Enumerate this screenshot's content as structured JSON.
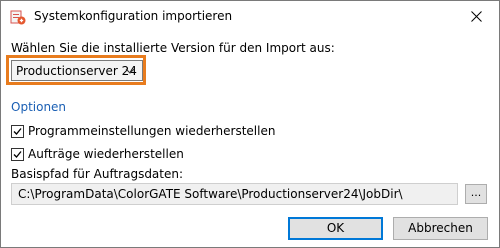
{
  "window": {
    "title": "Systemkonfiguration importieren",
    "app_icon": "import-app-icon",
    "close_icon": "close-icon"
  },
  "prompt_label": "Wählen Sie die installierte Version für den Import aus:",
  "version_select": {
    "value": "Productionserver 24",
    "highlight_color": "#e87c1e"
  },
  "options": {
    "section_title": "Optionen",
    "section_color": "#1a5fb4",
    "restore_settings": {
      "label": "Programmeinstellungen wiederherstellen",
      "checked": true
    },
    "restore_jobs": {
      "label": "Aufträge wiederherstellen",
      "checked": true
    }
  },
  "basepath": {
    "label": "Basispfad für Auftragsdaten:",
    "value": "C:\\ProgramData\\ColorGATE Software\\Productionserver24\\JobDir\\",
    "browse_label": "..."
  },
  "buttons": {
    "ok": "OK",
    "cancel": "Abbrechen"
  }
}
